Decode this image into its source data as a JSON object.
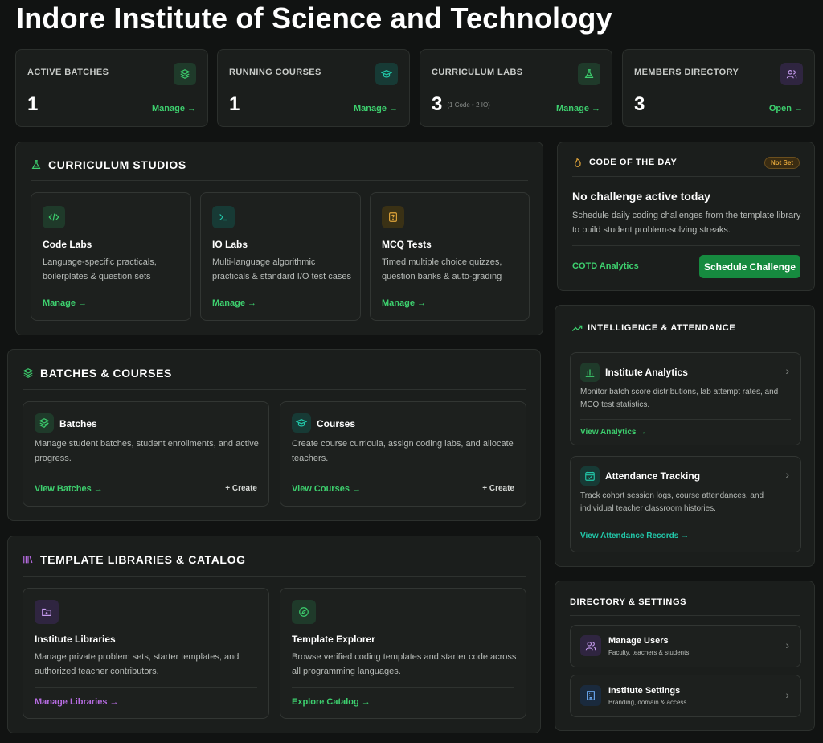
{
  "page_title": "Indore Institute of Science and Technology",
  "stats": [
    {
      "label": "ACTIVE BATCHES",
      "value": "1",
      "sub": "",
      "link": "Manage →",
      "icon": "layers-icon"
    },
    {
      "label": "RUNNING COURSES",
      "value": "1",
      "sub": "",
      "link": "Manage →",
      "icon": "graduation-cap-icon"
    },
    {
      "label": "CURRICULUM LABS",
      "value": "3",
      "sub": "(1 Code • 2 IO)",
      "link": "Manage →",
      "icon": "flask-icon"
    },
    {
      "label": "MEMBERS DIRECTORY",
      "value": "3",
      "sub": "",
      "link": "Open →",
      "icon": "users-icon"
    }
  ],
  "curriculum": {
    "title": "CURRICULUM STUDIOS",
    "cards": [
      {
        "title": "Code Labs",
        "desc1": "Language-specific practicals,",
        "desc2": "boilerplates & question sets",
        "link": "Manage →"
      },
      {
        "title": "IO Labs",
        "desc1": "Multi-language algorithmic",
        "desc2": "practicals & standard I/O test cases",
        "link": "Manage →"
      },
      {
        "title": "MCQ Tests",
        "desc1": "Timed multiple choice quizzes,",
        "desc2": "question banks & auto-grading",
        "link": "Manage →"
      }
    ]
  },
  "batches": {
    "title": "BATCHES & COURSES",
    "cards": [
      {
        "title": "Batches",
        "desc1": "Manage student batches, student enrollments, and active",
        "desc2": "progress.",
        "link": "View Batches →",
        "create": "+ Create"
      },
      {
        "title": "Courses",
        "desc1": "Create course curricula, assign coding labs, and allocate",
        "desc2": "teachers.",
        "link": "View Courses →",
        "create": "+ Create"
      }
    ]
  },
  "templates": {
    "title": "TEMPLATE LIBRARIES & CATALOG",
    "cards": [
      {
        "title": "Institute Libraries",
        "desc1": "Manage private problem sets, starter templates, and",
        "desc2": "authorized teacher contributors.",
        "link": "Manage Libraries →"
      },
      {
        "title": "Template Explorer",
        "desc1": "Browse verified coding templates and starter code across",
        "desc2": "all programming languages.",
        "link": "Explore Catalog →"
      }
    ]
  },
  "cotd": {
    "title": "CODE OF THE DAY",
    "badge": "Not Set",
    "heading": "No challenge active today",
    "desc1": "Schedule daily coding challenges from the template library",
    "desc2": "to build student problem-solving streaks.",
    "analytics_link": "COTD Analytics",
    "button": "Schedule Challenge"
  },
  "intel": {
    "title": "INTELLIGENCE & ATTENDANCE",
    "cards": [
      {
        "title": "Institute Analytics",
        "desc1": "Monitor batch score distributions, lab attempt rates, and",
        "desc2": "MCQ test statistics.",
        "link": "View Analytics →"
      },
      {
        "title": "Attendance Tracking",
        "desc1": "Track cohort session logs, course attendances, and",
        "desc2": "individual teacher classroom histories.",
        "link": "View Attendance Records →"
      }
    ]
  },
  "directory": {
    "title": "DIRECTORY & SETTINGS",
    "items": [
      {
        "title": "Manage Users",
        "sub": "Faculty, teachers & students"
      },
      {
        "title": "Institute Settings",
        "sub": "Branding, domain & access"
      }
    ]
  },
  "colors": {
    "accent_green": "#3dcf6e",
    "accent_purple": "#b56be0",
    "accent_teal": "#22c7a9",
    "badge_amber": "#e0a43a"
  }
}
